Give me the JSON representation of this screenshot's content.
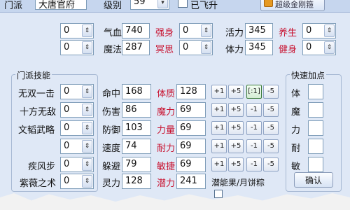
{
  "top": {
    "sect_label": "门派",
    "sect_value": "大唐官府",
    "level_label": "级别",
    "level_value": "59",
    "flying_label": "已飞升",
    "button_label": "超级金刚箍"
  },
  "row1": {
    "left_value": "0",
    "hp_label": "气血",
    "hp_value": "740",
    "strong_label": "强身",
    "strong_value": "0",
    "vigor_label": "活力",
    "vigor_value": "345",
    "nourish_label": "养生",
    "nourish_value": "0"
  },
  "row2": {
    "left_value": "0",
    "mp_label": "魔法",
    "mp_value": "287",
    "meditate_label": "冥思",
    "meditate_value": "0",
    "stamina_label": "体力",
    "stamina_value": "345",
    "fitness_label": "健身",
    "fitness_value": "0"
  },
  "skills": {
    "title": "门派技能",
    "items": [
      {
        "name": "无双一击",
        "value": "0"
      },
      {
        "name": "十方无敌",
        "value": "0"
      },
      {
        "name": "文韬武略",
        "value": "0"
      },
      {
        "name": "",
        "value": "0"
      },
      {
        "name": "疾风步",
        "value": "0"
      },
      {
        "name": "紫薇之术",
        "value": "0"
      }
    ]
  },
  "stats": [
    {
      "label": "命中",
      "value": "168",
      "attr": "体质",
      "attr_value": "128"
    },
    {
      "label": "伤害",
      "value": "86",
      "attr": "魔力",
      "attr_value": "69"
    },
    {
      "label": "防御",
      "value": "103",
      "attr": "力量",
      "attr_value": "69"
    },
    {
      "label": "速度",
      "value": "74",
      "attr": "耐力",
      "attr_value": "69"
    },
    {
      "label": "躲避",
      "value": "79",
      "attr": "敏捷",
      "attr_value": "69"
    },
    {
      "label": "灵力",
      "value": "128",
      "attr": "潜力",
      "attr_value": "241"
    }
  ],
  "adjust_buttons": {
    "plus1": "+1",
    "plus5": "+5",
    "minus1": "-1",
    "minus5": "-5",
    "special": "[:1]"
  },
  "potential_label": "潜能果/月饼粽",
  "quick": {
    "title": "快速加点",
    "items": [
      "体",
      "魔",
      "力",
      "耐",
      "敏"
    ],
    "ok_label": "确认"
  },
  "colors": {
    "red_label": "#c8102e",
    "panel_bg": "#dfe8f6"
  }
}
